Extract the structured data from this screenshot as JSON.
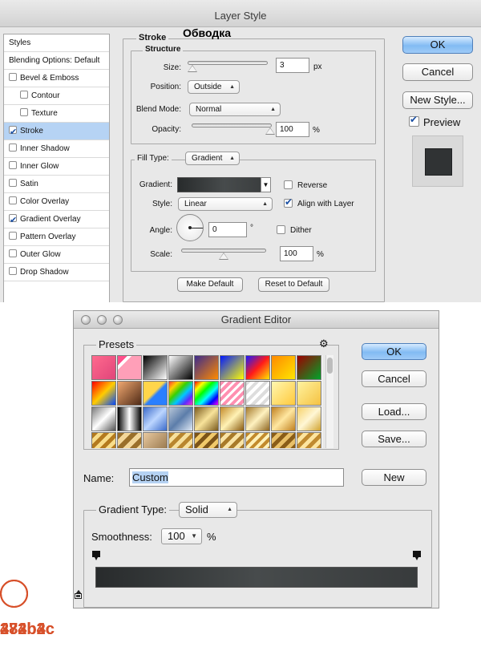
{
  "layer_style": {
    "title": "Layer Style",
    "sidebar": [
      {
        "label": "Styles",
        "checkbox": false
      },
      {
        "label": "Blending Options: Default",
        "checkbox": false
      },
      {
        "label": "Bevel & Emboss",
        "checkbox": true,
        "checked": false
      },
      {
        "label": "Contour",
        "checkbox": true,
        "checked": false,
        "sub": true
      },
      {
        "label": "Texture",
        "checkbox": true,
        "checked": false,
        "sub": true
      },
      {
        "label": "Stroke",
        "checkbox": true,
        "checked": true,
        "selected": true
      },
      {
        "label": "Inner Shadow",
        "checkbox": true,
        "checked": false
      },
      {
        "label": "Inner Glow",
        "checkbox": true,
        "checked": false
      },
      {
        "label": "Satin",
        "checkbox": true,
        "checked": false
      },
      {
        "label": "Color Overlay",
        "checkbox": true,
        "checked": false
      },
      {
        "label": "Gradient Overlay",
        "checkbox": true,
        "checked": true
      },
      {
        "label": "Pattern Overlay",
        "checkbox": true,
        "checked": false
      },
      {
        "label": "Outer Glow",
        "checkbox": true,
        "checked": false
      },
      {
        "label": "Drop Shadow",
        "checkbox": true,
        "checked": false
      }
    ],
    "panel_title": "Stroke",
    "annotation": "Обводка",
    "structure": {
      "legend": "Structure",
      "size_label": "Size:",
      "size_value": "3",
      "size_unit": "px",
      "size_fraction": 0.04,
      "position_label": "Position:",
      "position_value": "Outside",
      "blend_label": "Blend Mode:",
      "blend_value": "Normal",
      "opacity_label": "Opacity:",
      "opacity_value": "100",
      "opacity_unit": "%",
      "opacity_fraction": 1.0
    },
    "fill": {
      "type_label": "Fill Type:",
      "type_value": "Gradient",
      "gradient_label": "Gradient:",
      "reverse_label": "Reverse",
      "reverse_checked": false,
      "style_label": "Style:",
      "style_value": "Linear",
      "align_label": "Align with Layer",
      "align_checked": true,
      "angle_label": "Angle:",
      "angle_value": "0",
      "angle_unit": "°",
      "dither_label": "Dither",
      "dither_checked": false,
      "scale_label": "Scale:",
      "scale_value": "100",
      "scale_unit": "%",
      "scale_fraction": 0.5
    },
    "make_default": "Make Default",
    "reset_default": "Reset to Default",
    "ok": "OK",
    "cancel": "Cancel",
    "new_style": "New Style...",
    "preview_label": "Preview",
    "preview_checked": true
  },
  "gradient_editor": {
    "title": "Gradient Editor",
    "presets_label": "Presets",
    "gear_icon": "gear-icon",
    "ok": "OK",
    "cancel": "Cancel",
    "load": "Load...",
    "save": "Save...",
    "name_label": "Name:",
    "name_value": "Custom",
    "new_button": "New",
    "gradient_type_label": "Gradient Type:",
    "gradient_type_value": "Solid",
    "smoothness_label": "Smoothness:",
    "smoothness_value": "100",
    "smoothness_unit": "%",
    "stops": [
      {
        "location": 0.0,
        "color": "#282b2c",
        "label": "282b2c"
      },
      {
        "location": 0.5,
        "color": "#474b4c",
        "label": "474b4c"
      },
      {
        "location": 1.0,
        "color": "#383b3c",
        "label": "383b3c"
      }
    ]
  },
  "colors": {
    "annotation": "#d7502a",
    "selection": "#b6d3f4",
    "default_button": "#82bbf3"
  }
}
